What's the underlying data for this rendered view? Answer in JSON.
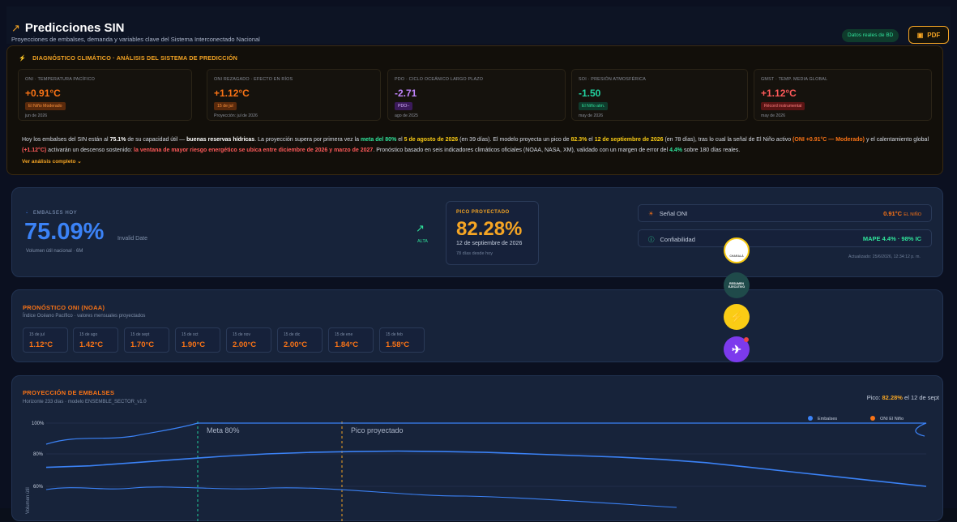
{
  "header": {
    "title": "Predicciones SIN",
    "subtitle": "Proyecciones de embalses, demanda y variables clave del Sistema Interconectado Nacional",
    "live_badge": "Datos reales de BD",
    "pdf_label": "PDF"
  },
  "diagnosis": {
    "heading": "DIAGNÓSTICO CLIMÁTICO · ANÁLISIS DEL SISTEMA DE PREDICCIÓN",
    "indicators": [
      {
        "label": "ONI · TEMPERATURA PACÍFICO",
        "value": "+0.91°C",
        "tag": "El Niño Moderado",
        "date": "jun de 2026",
        "color": "#f97316",
        "tag_bg": "#5a2a0c",
        "tag_color": "#fb923c"
      },
      {
        "label": "ONI REZAGADO · EFECTO EN RÍOS",
        "value": "+1.12°C",
        "tag": "15 de jul",
        "date": "Proyección: jul de 2026",
        "color": "#f97316",
        "tag_bg": "#5a2a0c",
        "tag_color": "#fb923c"
      },
      {
        "label": "PDO · CICLO OCEÁNICO LARGO PLAZO",
        "value": "-2.71",
        "tag": "PDO−",
        "date": "ago de 2025",
        "color": "#c084fc",
        "tag_bg": "#3b1a5a",
        "tag_color": "#d8b4fe"
      },
      {
        "label": "SOI · PRESIÓN ATMOSFÉRICA",
        "value": "-1.50",
        "tag": "El Niño atm.",
        "date": "may de 2026",
        "color": "#22d3a0",
        "tag_bg": "#0f3b2c",
        "tag_color": "#30e39b"
      },
      {
        "label": "GMST · TEMP. MEDIA GLOBAL",
        "value": "+1.12°C",
        "tag": "Récord instrumental",
        "date": "may de 2026",
        "color": "#ff5a5a",
        "tag_bg": "#5a1414",
        "tag_color": "#ff8080"
      }
    ],
    "summary": {
      "s1": "Hoy los embalses del SIN están al ",
      "s2": "75.1%",
      "s3": " de su capacidad útil — ",
      "s4": "buenas reservas hídricas",
      "s5": ". La proyección supera por primera vez la ",
      "s6": "meta del 80%",
      "s7": " el ",
      "s8": "5 de agosto de 2026",
      "s9": " (en 39 días). El modelo proyecta un pico de ",
      "s10": "82.3%",
      "s11": " el ",
      "s12": "12 de septiembre de 2026",
      "s13": " (en 78 días), tras lo cual la señal de El Niño activo ",
      "s14": "(ONI +0.91°C — Moderado)",
      "s15": " y el calentamiento global ",
      "s16": "(+1.12°C)",
      "s17": " activarán un descenso sostenido: ",
      "s18": "la ventana de mayor riesgo energético se ubica entre diciembre de 2026 y marzo de 2027",
      "s19": ". Pronóstico basado en seis indicadores climáticos oficiales (NOAA, NASA, XM), validado con un margen de error del ",
      "s20": "4.4%",
      "s21": " sobre 180 días reales."
    },
    "more": "Ver análisis completo"
  },
  "reservoir": {
    "label": "EMBALSES HOY",
    "value": "75.09%",
    "invalid": "Invalid Date",
    "sub": "Volumen útil nacional · 6M",
    "trend": "ALTA",
    "peak": {
      "heading": "PICO PROYECTADO",
      "value": "82.28%",
      "date": "12 de septiembre de 2026",
      "since": "78 días desde hoy"
    },
    "signal": {
      "label": "Señal ONI",
      "value": "0.91°C",
      "suffix": "EL NIÑO"
    },
    "confidence": {
      "label": "Confiabilidad",
      "value": "MAPE 4.4% · 98% IC"
    },
    "updated": "Actualizado: 25/6/2026, 12:34:12 p. m."
  },
  "oni": {
    "heading": "PRONÓSTICO ONI (NOAA)",
    "sub": "Índice Océano Pacífico · valores mensuales proyectados",
    "months": [
      {
        "m": "15 de jul",
        "v": "1.12°C"
      },
      {
        "m": "15 de ago",
        "v": "1.42°C"
      },
      {
        "m": "15 de sept",
        "v": "1.70°C"
      },
      {
        "m": "15 de oct",
        "v": "1.90°C"
      },
      {
        "m": "15 de nov",
        "v": "2.00°C"
      },
      {
        "m": "15 de dic",
        "v": "2.00°C"
      },
      {
        "m": "15 de ene",
        "v": "1.84°C"
      },
      {
        "m": "15 de feb",
        "v": "1.58°C"
      }
    ]
  },
  "projection": {
    "heading": "PROYECCIÓN DE EMBALSES",
    "sub": "Horizonte 233 días · modelo ENSEMBLE_SECTOR_v1.0",
    "peak_prefix": "Pico: ",
    "peak_value": "82.28%",
    "peak_suffix": " el 12 de sept"
  },
  "chart_data": {
    "type": "line",
    "ylabel": "Volumen útil",
    "y_ticks": [
      "100%",
      "80%",
      "60%"
    ],
    "legend": [
      "Embalses",
      "ONI El Niño"
    ],
    "annotations": [
      "Meta 80%",
      "Pico proyectado"
    ],
    "series": [
      {
        "name": "Embalses",
        "values": [
          72,
          73,
          75,
          77,
          79,
          80.5,
          81.5,
          82,
          82.3,
          82,
          81.5,
          80.5,
          79.5,
          78.5,
          77,
          75,
          72,
          69,
          66,
          63,
          60
        ]
      }
    ]
  },
  "fabs": {
    "f1": "CHARALÁ",
    "f2": "RESUMEN EJECUTIVO"
  }
}
